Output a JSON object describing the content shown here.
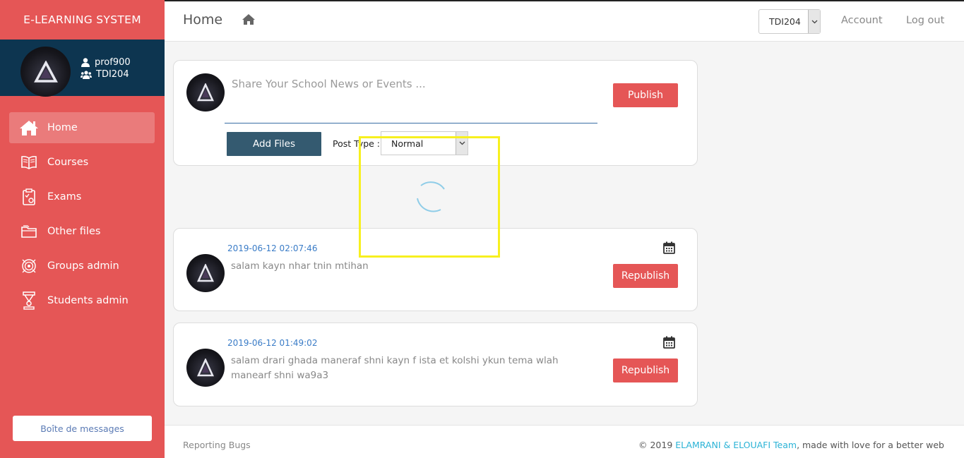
{
  "sidebar": {
    "brand": "E-LEARNING SYSTEM",
    "user": {
      "username": "prof900",
      "group": "TDI204"
    },
    "items": [
      {
        "label": "Home",
        "icon": "home-icon",
        "active": true
      },
      {
        "label": "Courses",
        "icon": "book-icon"
      },
      {
        "label": "Exams",
        "icon": "exam-icon"
      },
      {
        "label": "Other files",
        "icon": "folder-icon"
      },
      {
        "label": "Groups admin",
        "icon": "target-icon"
      },
      {
        "label": "Students admin",
        "icon": "trophy-icon"
      }
    ],
    "messages_button": "Boîte de messages"
  },
  "header": {
    "title": "Home",
    "group_select": "TDI204",
    "account": "Account",
    "logout": "Log out"
  },
  "composer": {
    "placeholder": "Share Your School News or Events ...",
    "publish": "Publish",
    "add_files": "Add Files",
    "post_type_label": "Post Type :",
    "post_type_value": "Normal"
  },
  "posts": [
    {
      "date": "2019-06-12 02:07:46",
      "text": "salam kayn nhar tnin mtihan",
      "action": "Republish"
    },
    {
      "date": "2019-06-12 01:49:02",
      "text": "salam drari ghada maneraf shni kayn f ista et kolshi ykun tema wlah manearf shni wa9a3",
      "action": "Republish"
    }
  ],
  "footer": {
    "left": "Reporting Bugs",
    "right_prefix": "© 2019 ",
    "team": "ELAMRANI & ELOUAFI Team",
    "right_suffix": ", made with love for a better web"
  },
  "colors": {
    "sidebar": "#e55656",
    "user_panel": "#0d3550",
    "accent_blue": "#3a7cc7",
    "dark_button": "#345a70",
    "highlight": "#f7f01f"
  }
}
